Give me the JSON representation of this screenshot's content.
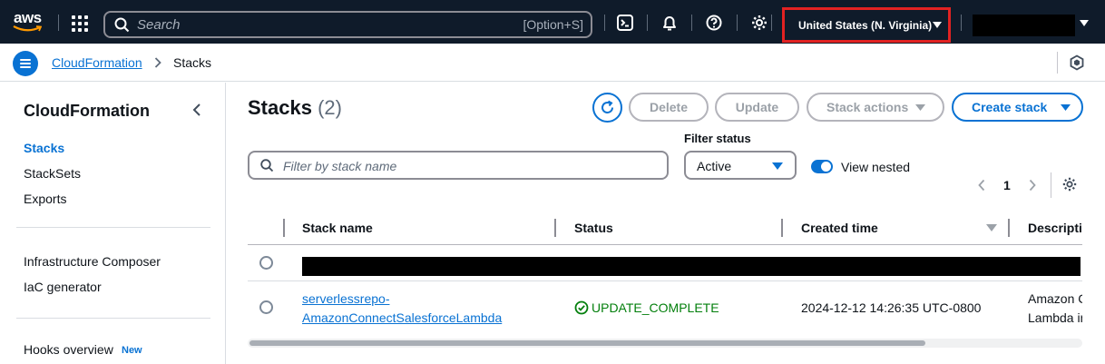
{
  "topnav": {
    "logo_text": "aws",
    "search_placeholder": "Search",
    "search_shortcut": "[Option+S]",
    "region": "United States (N. Virginia)"
  },
  "breadcrumb": {
    "items": [
      "CloudFormation",
      "Stacks"
    ]
  },
  "sidebar": {
    "title": "CloudFormation",
    "items": [
      {
        "label": "Stacks",
        "active": true
      },
      {
        "label": "StackSets"
      },
      {
        "label": "Exports"
      },
      {
        "label": "Infrastructure Composer"
      },
      {
        "label": "IaC generator"
      },
      {
        "label": "Hooks overview",
        "badge": "New"
      }
    ]
  },
  "main": {
    "title": "Stacks",
    "count": "(2)",
    "buttons": {
      "delete": "Delete",
      "update": "Update",
      "stack_actions": "Stack actions",
      "create_stack": "Create stack"
    },
    "filter_placeholder": "Filter by stack name",
    "filter_status_label": "Filter status",
    "filter_status_value": "Active",
    "view_nested_label": "View nested",
    "view_nested_on": true,
    "page": "1"
  },
  "table": {
    "columns": [
      "Stack name",
      "Status",
      "Created time",
      "Descriptio"
    ],
    "rows": [
      {
        "redacted": true
      },
      {
        "name_line1": "serverlessrepo-",
        "name_line2": "AmazonConnectSalesforceLambda",
        "status": "UPDATE_COMPLETE",
        "created": "2024-12-12 14:26:35 UTC-0800",
        "description_line1": "Amazon C",
        "description_line2": "Lambda in"
      }
    ]
  },
  "colors": {
    "nav_bg": "#0f1b2a",
    "accent": "#0972d3",
    "success": "#037f0c",
    "region_highlight": "#e22222"
  }
}
